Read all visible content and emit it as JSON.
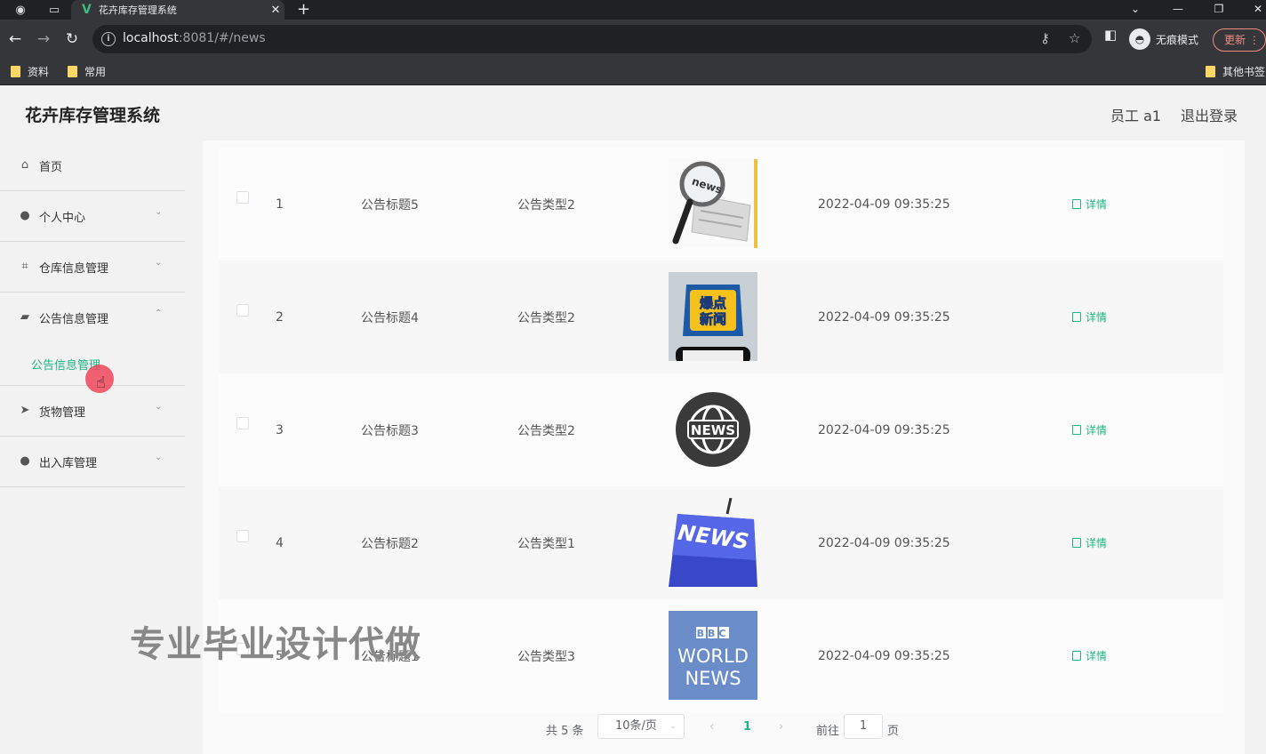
{
  "browser": {
    "tab_title": "花卉库存管理系统",
    "url_host": "localhost",
    "url_rest": ":8081/#/news",
    "incognito_label": "无痕模式",
    "update_label": "更新",
    "bookmarks": [
      "资料",
      "常用"
    ],
    "other_bookmarks": "其他书签"
  },
  "app": {
    "title": "花卉库存管理系统",
    "user_label": "员工 a1",
    "logout_label": "退出登录"
  },
  "sidebar": {
    "items": [
      {
        "label": "首页",
        "icon": "home-icon"
      },
      {
        "label": "个人中心",
        "icon": "user-icon"
      },
      {
        "label": "仓库信息管理",
        "icon": "crop-icon"
      },
      {
        "label": "公告信息管理",
        "icon": "megaphone-icon"
      },
      {
        "label": "货物管理",
        "icon": "send-icon"
      },
      {
        "label": "出入库管理",
        "icon": "user-icon"
      }
    ],
    "sub_item": "公告信息管理"
  },
  "table": {
    "action_label": "详情",
    "rows": [
      {
        "index": "1",
        "title": "公告标题5",
        "type": "公告类型2",
        "time": "2022-04-09 09:35:25",
        "image": "magnifier-news"
      },
      {
        "index": "2",
        "title": "公告标题4",
        "type": "公告类型2",
        "time": "2022-04-09 09:35:25",
        "image": "hot-news-phone"
      },
      {
        "index": "3",
        "title": "公告标题3",
        "type": "公告类型2",
        "time": "2022-04-09 09:35:25",
        "image": "news-globe"
      },
      {
        "index": "4",
        "title": "公告标题2",
        "type": "公告类型1",
        "time": "2022-04-09 09:35:25",
        "image": "news-key"
      },
      {
        "index": "5",
        "title": "公告标题1",
        "type": "公告类型3",
        "time": "2022-04-09 09:35:25",
        "image": "bbc-world-news"
      }
    ]
  },
  "pagination": {
    "total": "共 5 条",
    "page_size": "10条/页",
    "current": "1",
    "goto_label": "前往",
    "goto_value": "1",
    "page_suffix": "页"
  },
  "watermark": "专业毕业设计代做",
  "image_text": {
    "magnifier": "news",
    "hot_news_line1": "爆点",
    "hot_news_line2": "新闻",
    "globe": "NEWS",
    "key": "NEWS",
    "bbc": "BBC",
    "world": "WORLD",
    "news": "NEWS"
  },
  "colors": {
    "accent": "#1fb584",
    "chrome_dark": "#202124",
    "chrome_bar": "#35363a"
  }
}
